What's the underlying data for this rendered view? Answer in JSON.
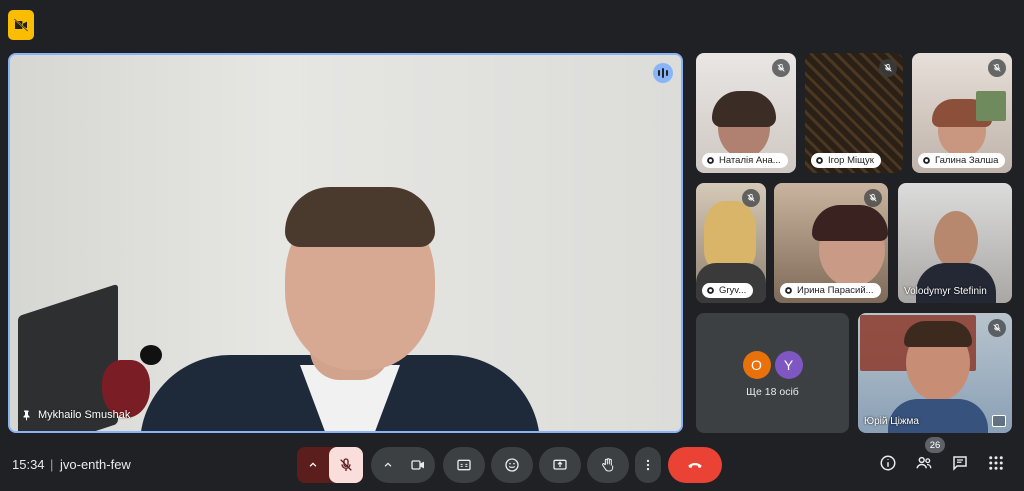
{
  "main": {
    "speaker_name": "Mykhailo Smushak"
  },
  "tiles": [
    {
      "name": "Наталія Ана...",
      "muted": true
    },
    {
      "name": "Ігор Міщук",
      "muted": true
    },
    {
      "name": "Галина Залша",
      "muted": true
    },
    {
      "name": "Gryv...",
      "muted": true
    },
    {
      "name": "Ирина Парасий...",
      "muted": true
    },
    {
      "name": "Volodymyr Stefinin",
      "muted": false
    },
    {
      "name": "Юрій Ціжма",
      "muted": true
    }
  ],
  "more_tile": {
    "avatars": [
      {
        "letter": "O",
        "color": "#e8710a"
      },
      {
        "letter": "Y",
        "color": "#7e57c2"
      }
    ],
    "label": "Ще 18 осіб"
  },
  "bottom_bar": {
    "time": "15:34",
    "separator": "|",
    "meeting_code": "jvo-enth-few",
    "participants_count": "26"
  },
  "colors": {
    "background": "#202124",
    "active_border": "#8ab4f8",
    "end_call": "#ea4335",
    "mic_off_bg": "#f9dedc",
    "badge": "#fbbc04"
  }
}
